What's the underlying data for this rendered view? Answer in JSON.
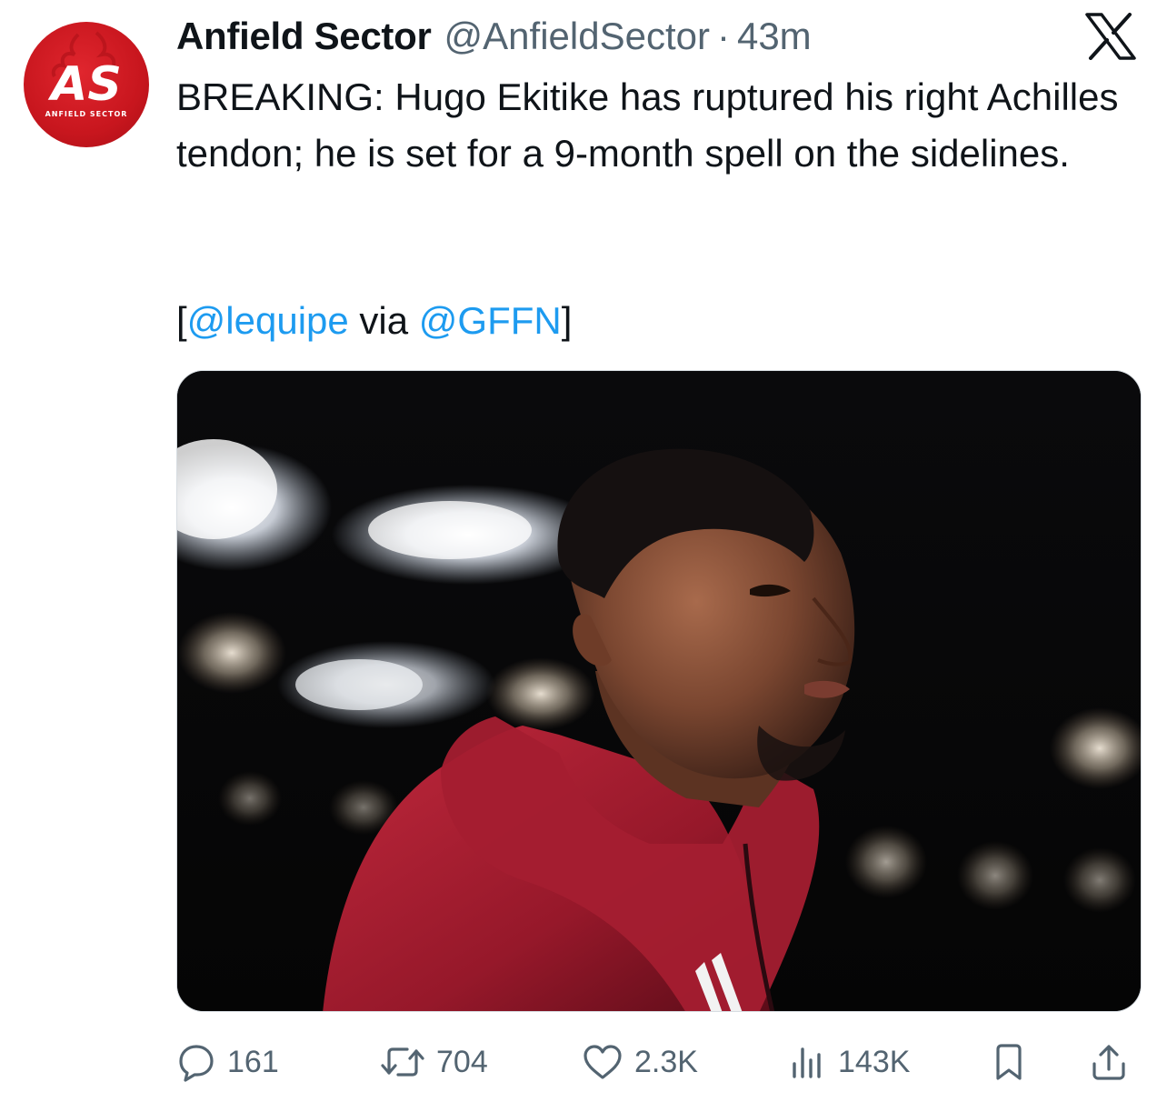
{
  "tweet": {
    "author_name": "Anfield Sector",
    "handle": "@AnfieldSector",
    "separator": "·",
    "time": "43m",
    "avatar_monogram": "AS",
    "avatar_caption": "ANFIELD SECTOR",
    "text": "BREAKING: Hugo Ekitike has ruptured his right Achilles tendon; he is set for a 9-month spell on the sidelines.",
    "source": {
      "open_bracket": "[",
      "mention_1": "@lequipe",
      "via": " via ",
      "mention_2": "@GFFN",
      "close_bracket": "]"
    }
  },
  "actions": {
    "replies": "161",
    "reposts": "704",
    "likes": "2.3K",
    "views": "143K"
  },
  "icons": {
    "reply": "speech-bubble-icon",
    "repost": "repost-arrows-icon",
    "like": "heart-icon",
    "views": "bar-chart-icon",
    "bookmark": "bookmark-icon",
    "share": "share-icon",
    "brand": "x-logo-icon"
  },
  "colors": {
    "text": "#0f1419",
    "secondary": "#536471",
    "link": "#1d9bf0",
    "avatar_red": "#d11f26"
  }
}
